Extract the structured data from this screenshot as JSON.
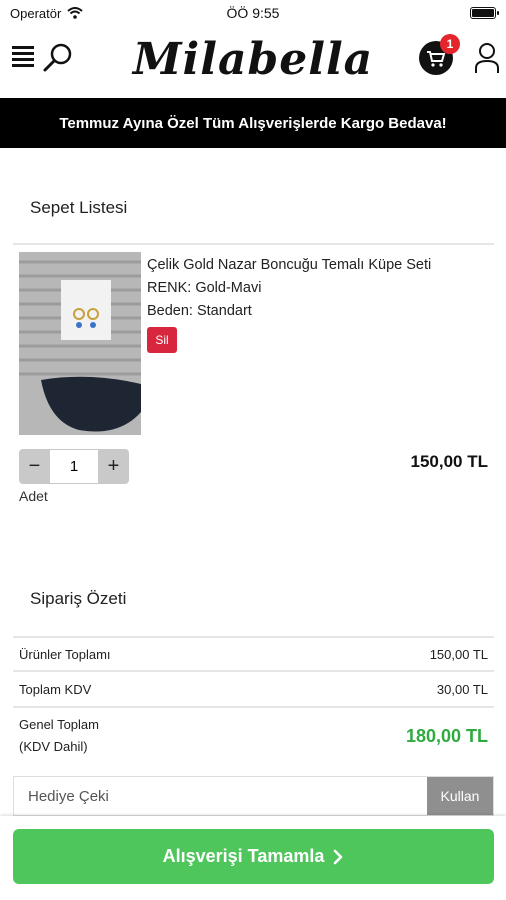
{
  "status_bar": {
    "carrier": "Operatör",
    "time": "ÖÖ 9:55"
  },
  "header": {
    "logo": "Milabella",
    "cart_count": "1"
  },
  "banner": {
    "text": "Temmuz Ayına Özel Tüm Alışverişlerde Kargo Bedava!"
  },
  "cart": {
    "title": "Sepet Listesi",
    "item": {
      "name": "Çelik Gold Nazar Boncuğu Temalı Küpe Seti",
      "color": "RENK: Gold-Mavi",
      "size": "Beden: Standart",
      "delete_label": "Sil",
      "quantity": "1",
      "quantity_label": "Adet",
      "price": "150,00 TL"
    }
  },
  "summary": {
    "title": "Sipariş Özeti",
    "rows": [
      {
        "label": "Ürünler Toplamı",
        "value": "150,00 TL"
      },
      {
        "label": "Toplam KDV",
        "value": "30,00 TL"
      }
    ],
    "total_label_1": "Genel Toplam",
    "total_label_2": "(KDV Dahil)",
    "total_value": "180,00 TL"
  },
  "gift": {
    "placeholder": "Hediye Çeki",
    "button": "Kullan"
  },
  "checkout": {
    "label": "Alışverişi Tamamla"
  },
  "colors": {
    "accent_green": "#4ec65c",
    "total_green": "#2eaa3f",
    "delete_red": "#d7263d",
    "badge_red": "#e3262b"
  }
}
